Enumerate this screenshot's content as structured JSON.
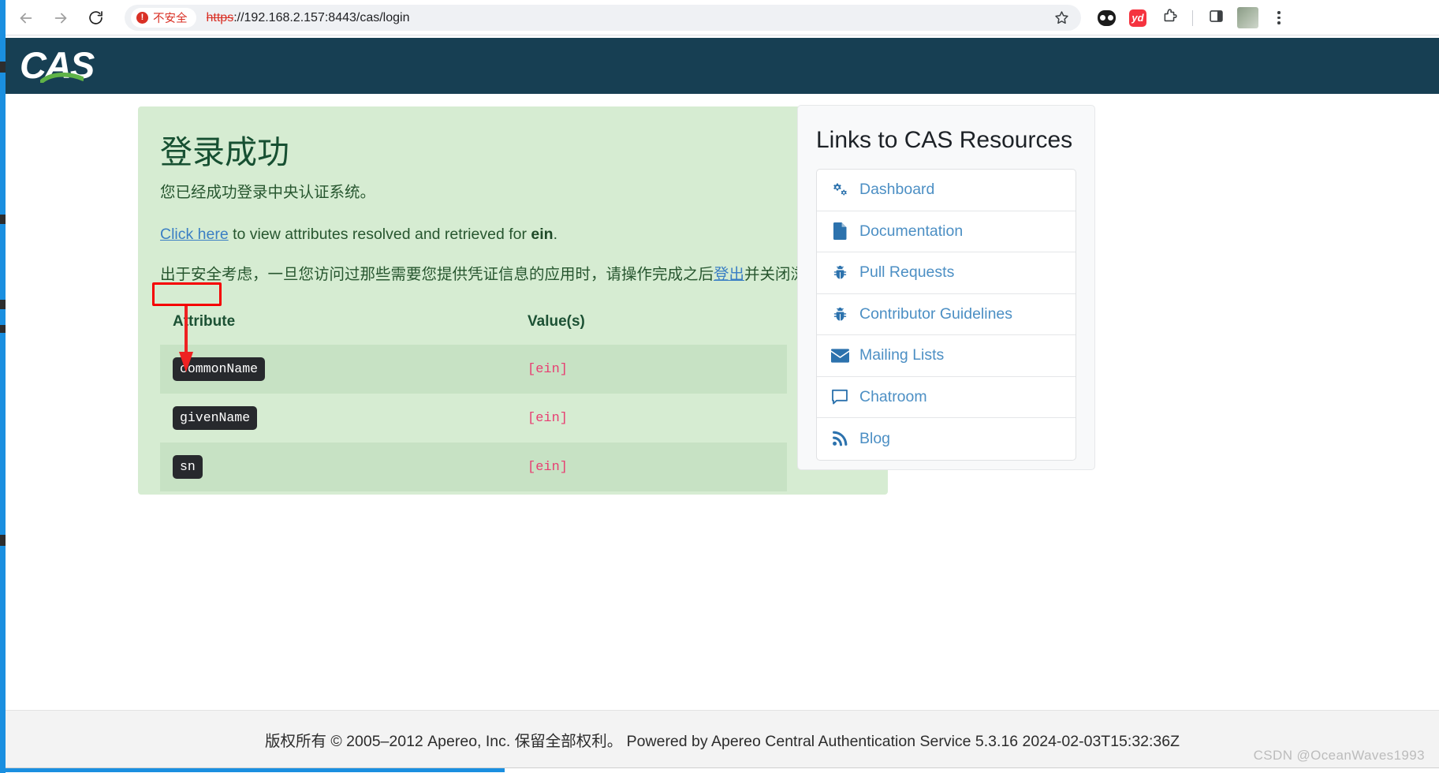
{
  "browser": {
    "back_icon": "back-arrow-icon",
    "forward_icon": "forward-arrow-icon",
    "reload_icon": "reload-icon",
    "security_label": "不安全",
    "security_icon": "danger-circle-icon",
    "url_scheme": "https",
    "url_rest": "://192.168.2.157:8443/cas/login",
    "bookmark_icon": "star-outline-icon",
    "extensions": [
      {
        "name": "pocket-extension-icon",
        "label": ""
      },
      {
        "name": "youdao-dictionary-extension-icon",
        "label": "yd"
      },
      {
        "name": "extensions-puzzle-icon",
        "label": ""
      },
      {
        "name": "side-panel-icon",
        "label": ""
      }
    ],
    "profile_icon": "profile-avatar",
    "menu_icon": "kebab-menu-icon"
  },
  "header": {
    "logo_text": "CAS",
    "logo_swoosh": "green-swoosh-icon",
    "background_color": "#173f53"
  },
  "success": {
    "title": "登录成功",
    "subtitle": "您已经成功登录中央认证系统。",
    "attr_link_text": "Click here",
    "attr_intro_middle": " to view attributes resolved and retrieved for ",
    "attr_intro_user": "ein",
    "attr_intro_end": ".",
    "security_note_before": "出于安全考虑，一旦您访问过那些需要您提供凭证信息的应用时，请操作完成之后",
    "security_note_link": "登出",
    "security_note_after": "并关闭浏览器。",
    "panel_color": "#d6ecd2"
  },
  "attributes_table": {
    "headers": [
      "Attribute",
      "Value(s)"
    ],
    "rows": [
      {
        "attribute": "commonName",
        "value": "[ein]",
        "striped": true
      },
      {
        "attribute": "givenName",
        "value": "[ein]",
        "striped": false
      },
      {
        "attribute": "sn",
        "value": "[ein]",
        "striped": true
      }
    ]
  },
  "links_panel": {
    "title": "Links to CAS Resources",
    "items": [
      {
        "label": "Dashboard",
        "icon": "cogs-icon"
      },
      {
        "label": "Documentation",
        "icon": "file-icon"
      },
      {
        "label": "Pull Requests",
        "icon": "bug-icon"
      },
      {
        "label": "Contributor Guidelines",
        "icon": "bug-icon"
      },
      {
        "label": "Mailing Lists",
        "icon": "envelope-icon"
      },
      {
        "label": "Chatroom",
        "icon": "comment-icon"
      },
      {
        "label": "Blog",
        "icon": "rss-feed-icon"
      }
    ]
  },
  "footer": {
    "text": "版权所有 © 2005–2012 Apereo, Inc. 保留全部权利。 Powered by Apereo Central Authentication Service 5.3.16 2024-02-03T15:32:36Z"
  },
  "watermark": {
    "text": "CSDN @OceanWaves1993"
  },
  "annotations": {
    "highlight_box_color": "#f50000",
    "arrow_color": "#ee2222"
  }
}
